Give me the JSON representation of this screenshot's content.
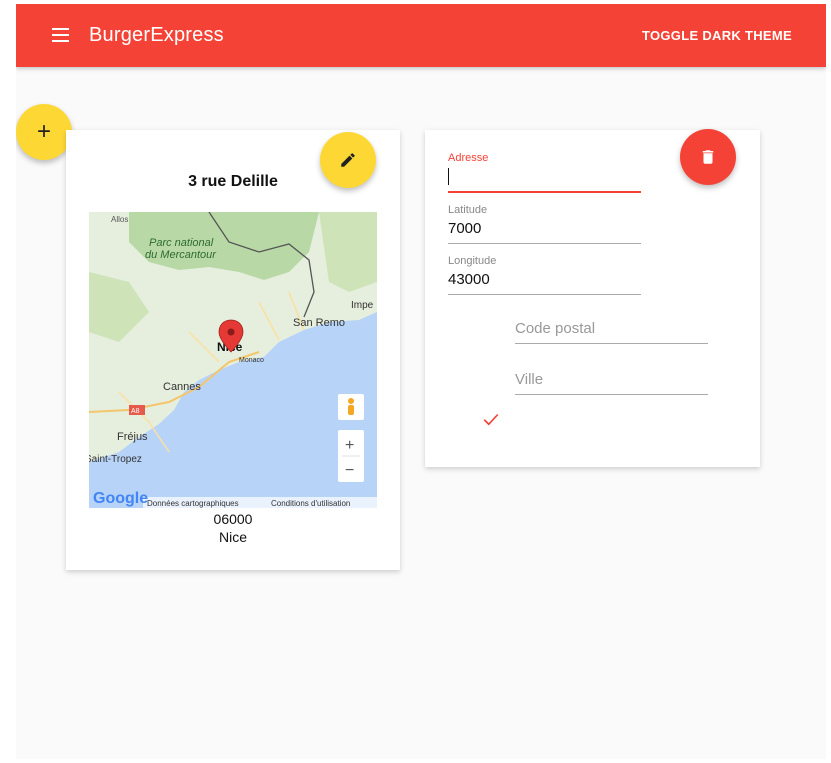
{
  "toolbar": {
    "title": "BurgerExpress",
    "toggle_label": "TOGGLE DARK THEME",
    "color": "#f44336"
  },
  "fab_add_label": "+",
  "card": {
    "address": "3 rue Delille",
    "postal_code": "06000",
    "city": "Nice",
    "map": {
      "labels": {
        "allos": "Allos",
        "park": "Parc national",
        "park2": "du Mercantour",
        "impe": "Impe",
        "sanremo": "San Remo",
        "nice": "Nice",
        "monaco": "Monaco",
        "cannes": "Cannes",
        "a8": "A8",
        "frejus": "Fréjus",
        "tropez": "Saint-Tropez",
        "google": "Google",
        "data": "Données cartographiques",
        "terms": "Conditions d'utilisation",
        "zoom_in": "+",
        "zoom_out": "−"
      }
    }
  },
  "form": {
    "adresse_label": "Adresse",
    "latitude_label": "Latitude",
    "latitude_value": "7000",
    "longitude_label": "Longitude",
    "longitude_value": "43000",
    "postal_placeholder": "Code postal",
    "ville_placeholder": "Ville"
  },
  "colors": {
    "accent": "#fdd835",
    "primary": "#f44336"
  }
}
